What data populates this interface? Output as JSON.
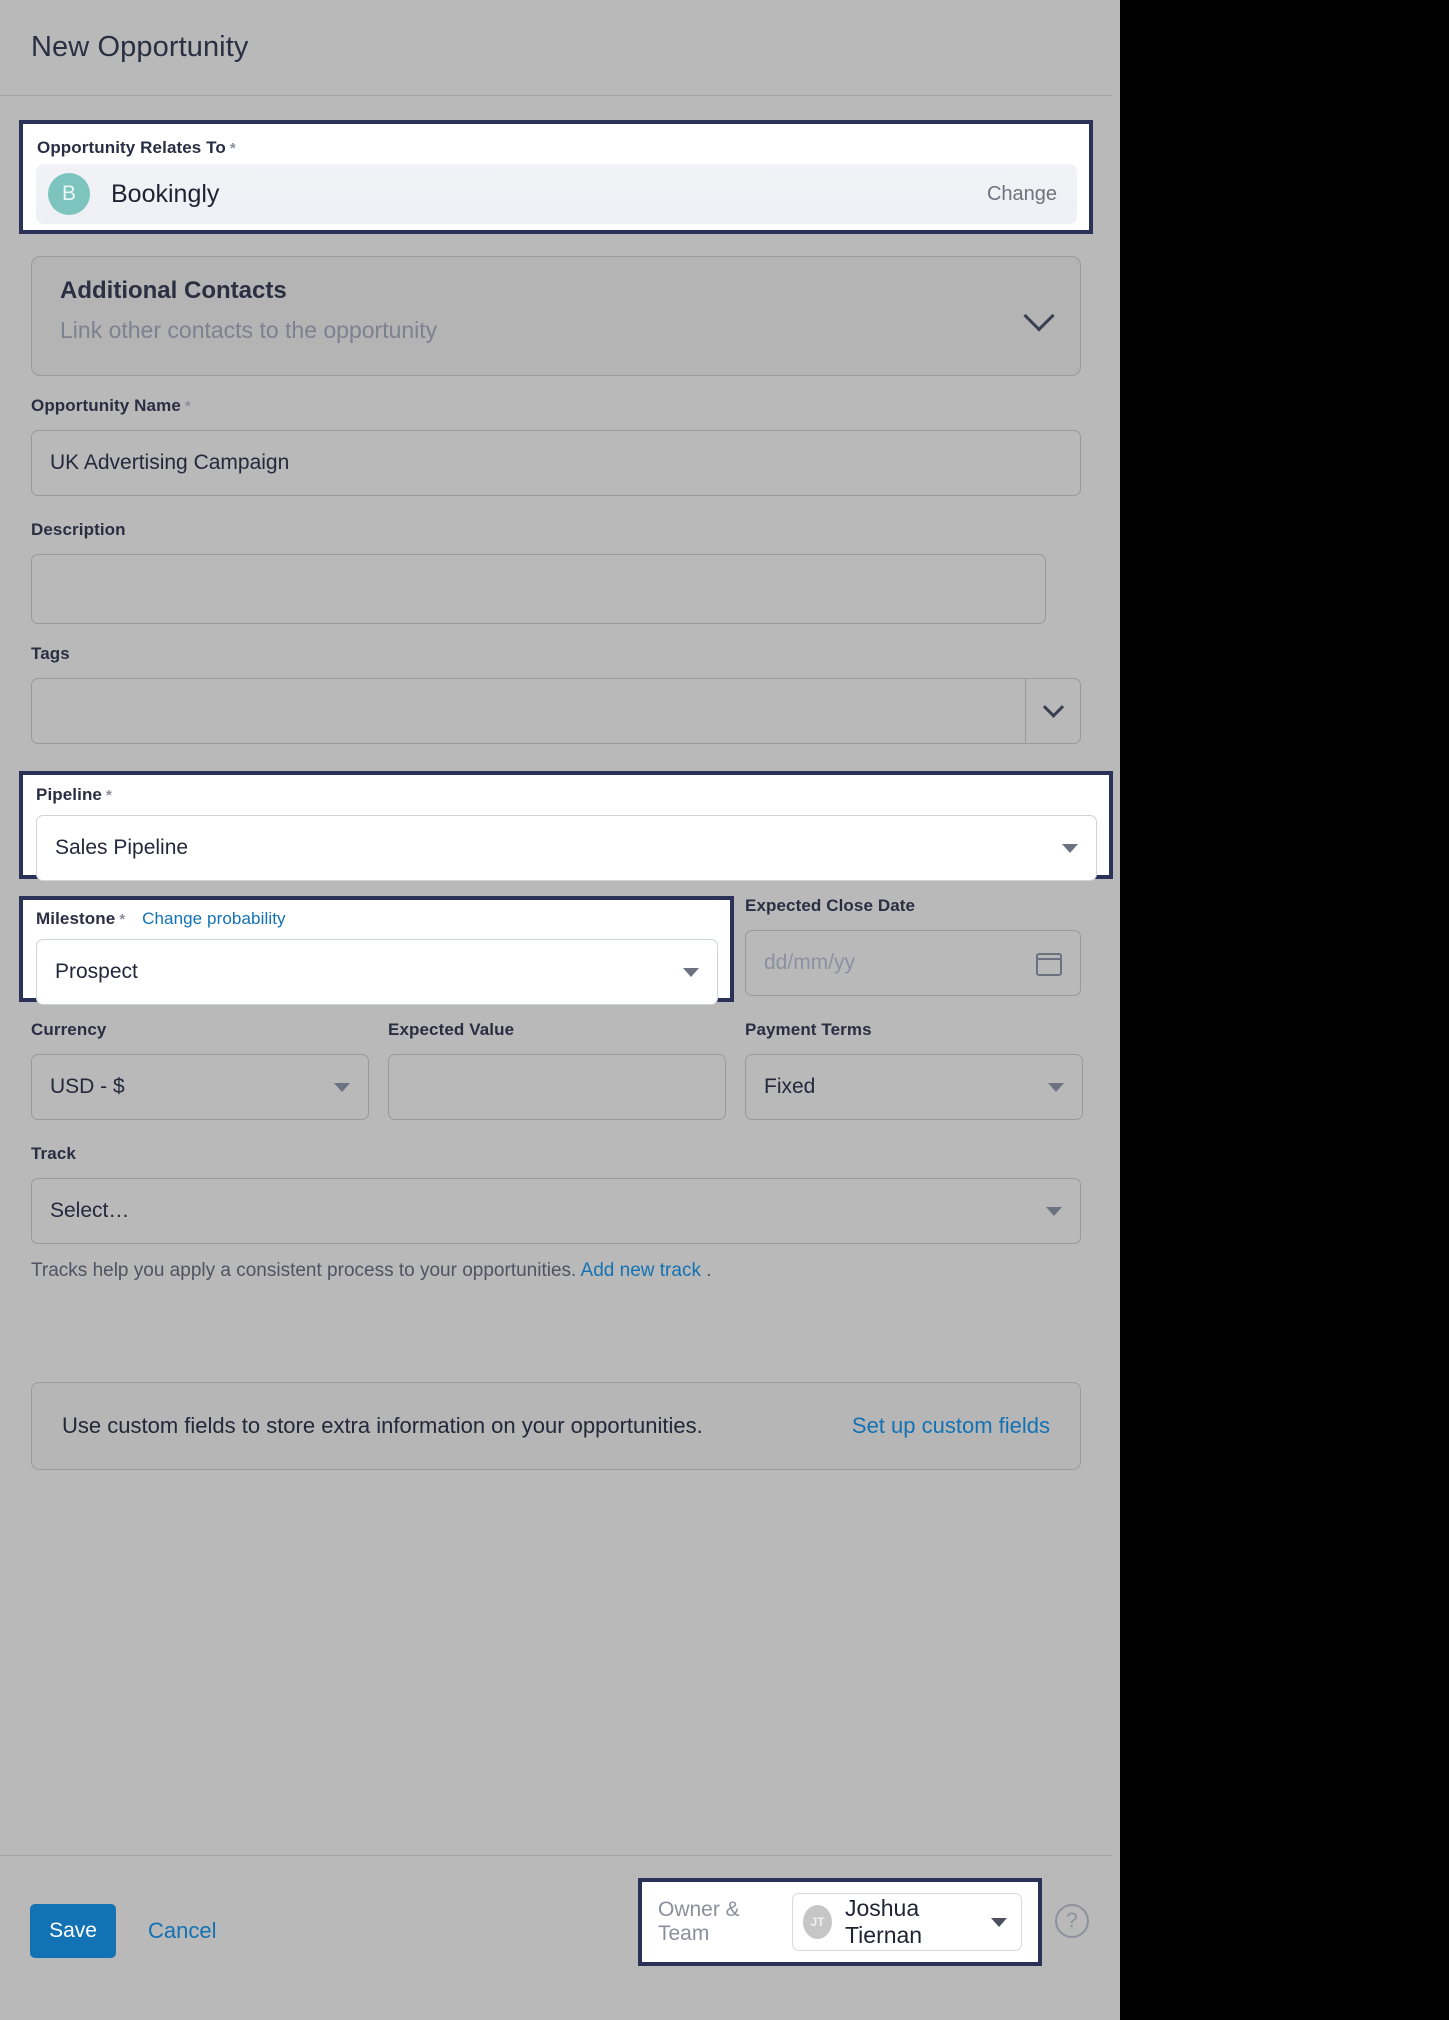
{
  "header": {
    "title": "New Opportunity"
  },
  "relates_to": {
    "label": "Opportunity Relates To",
    "required_mark": "*",
    "company_initial": "B",
    "company_name": "Bookingly",
    "change_label": "Change"
  },
  "additional_contacts": {
    "title": "Additional Contacts",
    "subtitle": "Link other contacts to the opportunity",
    "chevron": "chevron-down-icon"
  },
  "opportunity_name": {
    "label": "Opportunity Name",
    "required_mark": "*",
    "value": "UK Advertising Campaign"
  },
  "description": {
    "label": "Description",
    "value": ""
  },
  "tags": {
    "label": "Tags",
    "value": ""
  },
  "pipeline": {
    "label": "Pipeline",
    "required_mark": "*",
    "value": "Sales Pipeline"
  },
  "milestone": {
    "label": "Milestone",
    "required_mark": "*",
    "link": "Change probability",
    "value": "Prospect"
  },
  "expected_close_date": {
    "label": "Expected Close Date",
    "placeholder": "dd/mm/yy",
    "value": "",
    "icon": "calendar-icon"
  },
  "currency": {
    "label": "Currency",
    "value": "USD - $"
  },
  "expected_value": {
    "label": "Expected Value",
    "value": ""
  },
  "payment_terms": {
    "label": "Payment Terms",
    "value": "Fixed"
  },
  "track": {
    "label": "Track",
    "value": "Select…",
    "helper_prefix": "Tracks help you apply a consistent process to your opportunities.",
    "helper_link": "Add new track",
    "helper_suffix": "."
  },
  "custom_fields": {
    "text": "Use custom fields to store extra information on your opportunities.",
    "link": "Set up custom fields"
  },
  "footer": {
    "save_label": "Save",
    "cancel_label": "Cancel",
    "owner_label": "Owner & Team",
    "owner_initials": "JT",
    "owner_name": "Joshua Tiernan",
    "help_glyph": "?"
  },
  "colors": {
    "accent_blue": "#1272b4",
    "focus_navy": "#2b3258",
    "panel_grey": "#b9b9b9",
    "avatar_teal": "#7cc4bd"
  }
}
